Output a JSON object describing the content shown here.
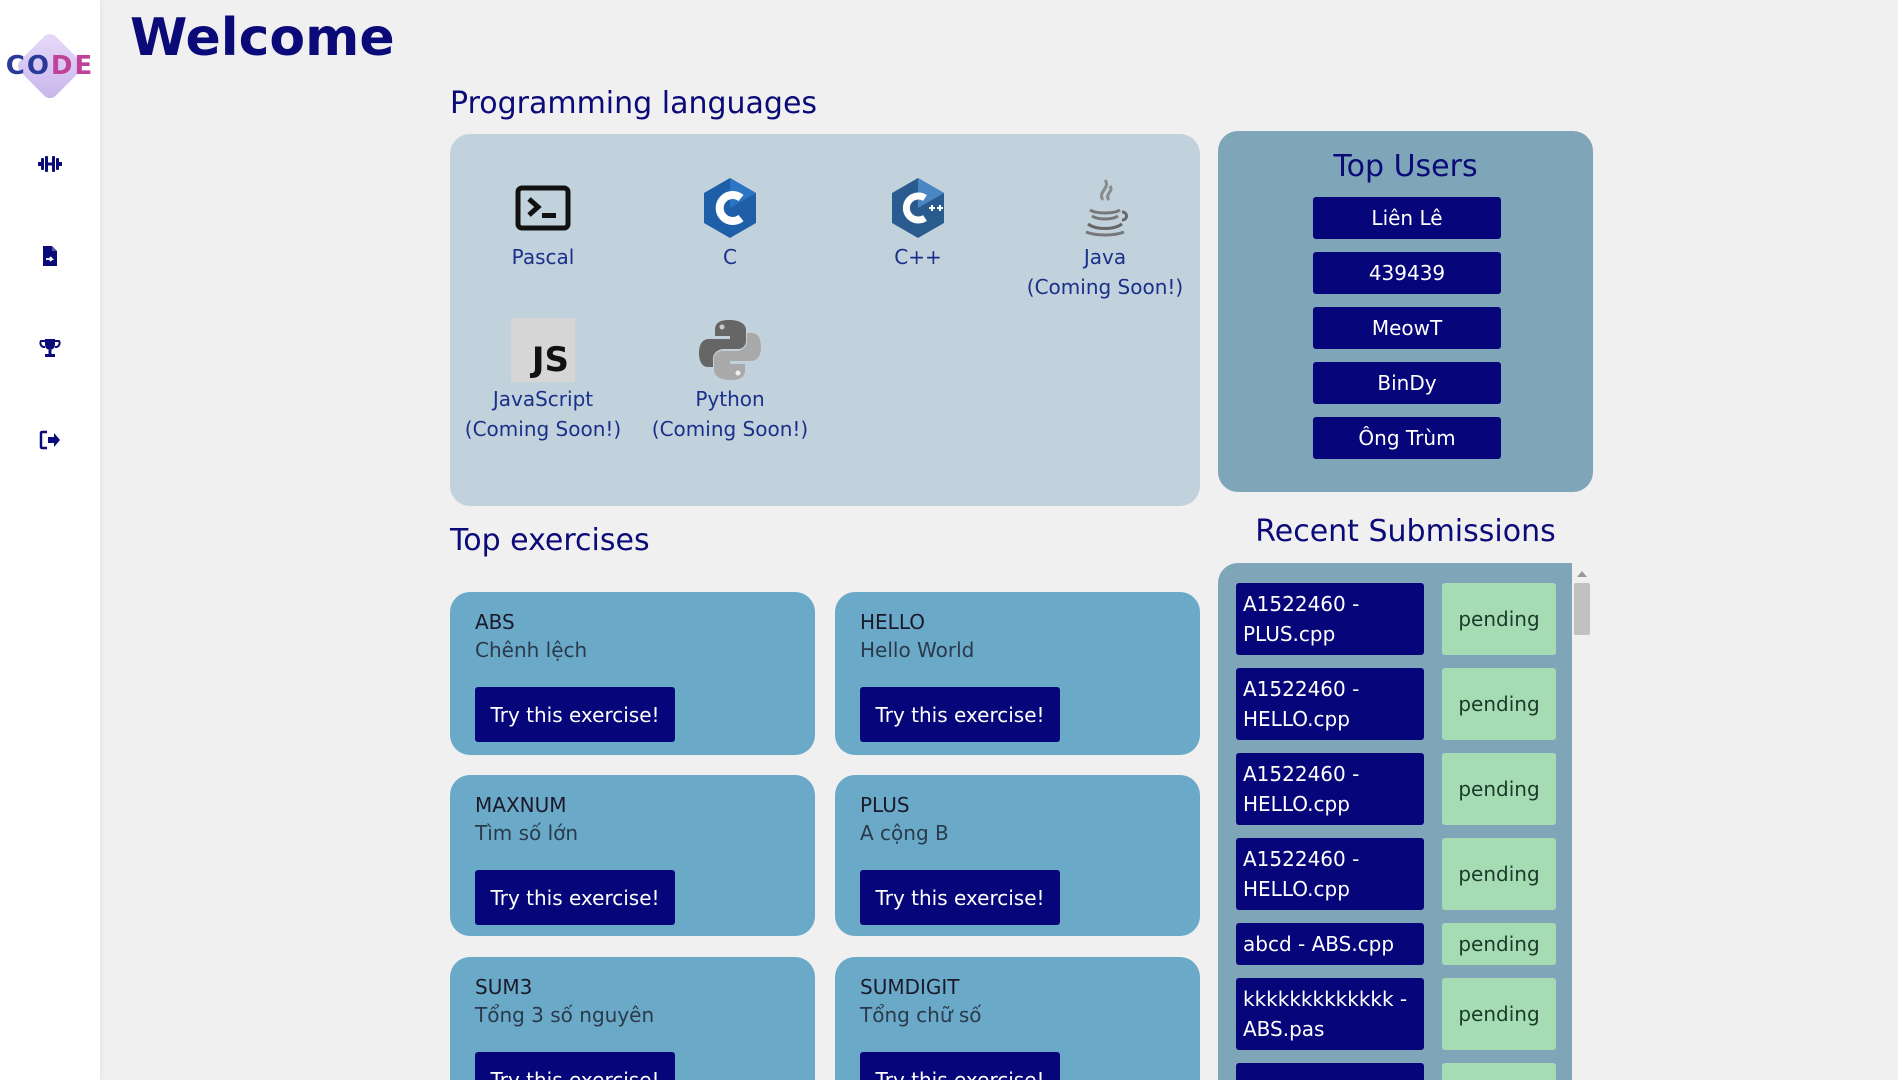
{
  "sidebar": {
    "logo_text_a": "CO",
    "logo_text_b": "DE",
    "icons": [
      "dumbbell-icon",
      "file-export-icon",
      "trophy-icon",
      "sign-out-icon"
    ]
  },
  "page": {
    "title": "Welcome"
  },
  "languages": {
    "title": "Programming languages",
    "items": [
      {
        "name": "Pascal",
        "note": ""
      },
      {
        "name": "C",
        "note": ""
      },
      {
        "name": "C++",
        "note": ""
      },
      {
        "name": "Java",
        "note": "(Coming Soon!)"
      },
      {
        "name": "JavaScript",
        "note": "(Coming Soon!)"
      },
      {
        "name": "Python",
        "note": "(Coming Soon!)"
      }
    ],
    "js_icon_text": "JS"
  },
  "top_users": {
    "title": "Top Users",
    "users": [
      "Liên Lê",
      "439439",
      "MeowT",
      "BinDy",
      "Ông Trùm"
    ]
  },
  "exercises": {
    "title": "Top exercises",
    "items": [
      {
        "code": "ABS",
        "name": "Chênh lệch",
        "button": "Try this exercise!"
      },
      {
        "code": "HELLO",
        "name": "Hello World",
        "button": "Try this exercise!"
      },
      {
        "code": "MAXNUM",
        "name": "Tìm số lớn",
        "button": "Try this exercise!"
      },
      {
        "code": "PLUS",
        "name": "A cộng B",
        "button": "Try this exercise!"
      },
      {
        "code": "SUM3",
        "name": "Tổng 3 số nguyên",
        "button": "Try this exercise!"
      },
      {
        "code": "SUMDIGIT",
        "name": "Tổng chữ số",
        "button": "Try this exercise!"
      }
    ]
  },
  "recent": {
    "title": "Recent Submissions",
    "items": [
      {
        "name": "A1522460 - PLUS.cpp",
        "status": "pending"
      },
      {
        "name": "A1522460 - HELLO.cpp",
        "status": "pending"
      },
      {
        "name": "A1522460 - HELLO.cpp",
        "status": "pending"
      },
      {
        "name": "A1522460 - HELLO.cpp",
        "status": "pending"
      },
      {
        "name": "abcd - ABS.cpp",
        "status": "pending"
      },
      {
        "name": "kkkkkkkkkkkkk - ABS.pas",
        "status": "pending"
      }
    ]
  },
  "colors": {
    "primary": "#06067a",
    "heading": "#0a0a78",
    "lang_panel": "#c2d2dc",
    "users_panel": "#7fa6b8",
    "exercise_card": "#6ba9c9",
    "status_pending": "#a6dcb4"
  }
}
